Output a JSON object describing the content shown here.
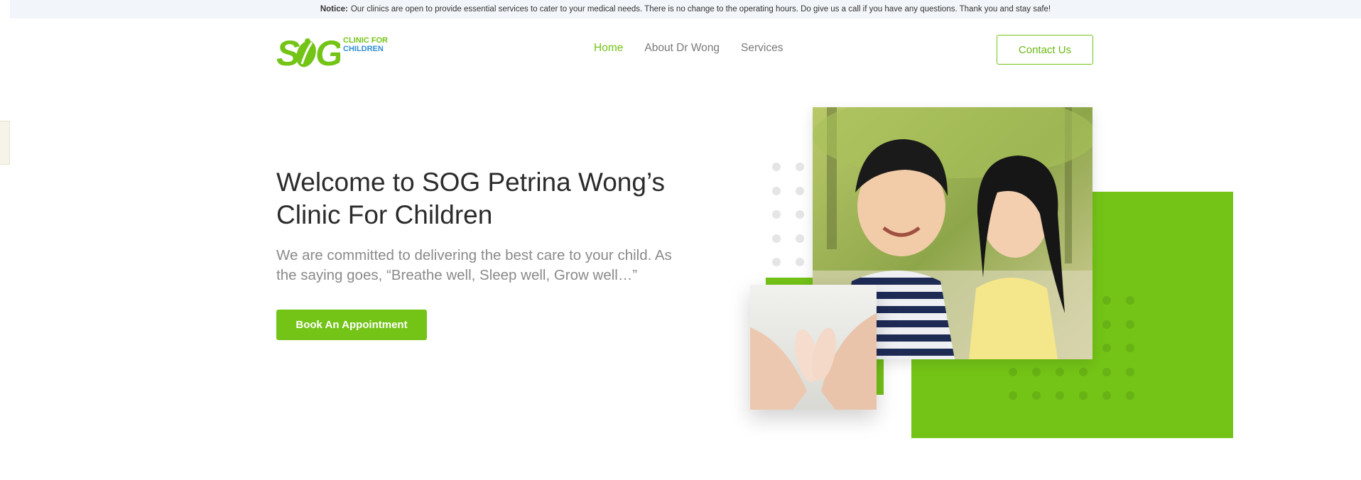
{
  "notice": {
    "label": "Notice:",
    "text": "Our clinics are open to provide essential services to cater to your medical needs. There is no change to the operating hours. Do give us a call if you have any questions. Thank you and stay safe!"
  },
  "logo": {
    "mark": "SOG",
    "line1": "CLINIC FOR",
    "line2": "CHILDREN"
  },
  "nav": {
    "items": [
      {
        "label": "Home",
        "active": true
      },
      {
        "label": "About Dr Wong",
        "active": false
      },
      {
        "label": "Services",
        "active": false
      }
    ]
  },
  "header": {
    "contact_label": "Contact Us"
  },
  "hero": {
    "title": "Welcome to SOG Petrina Wong’s Clinic For Children",
    "subtitle": "We are committed to delivering the best care to your child. As the saying goes, “Breathe well, Sleep well, Grow well…”",
    "cta_label": "Book An Appointment"
  },
  "images": {
    "main": "two-children-photo",
    "secondary": "baby-feet-hands-photo"
  },
  "colors": {
    "brand_green": "#74c417",
    "brand_blue": "#2f8fd6",
    "notice_bg": "#f2f5f9"
  }
}
